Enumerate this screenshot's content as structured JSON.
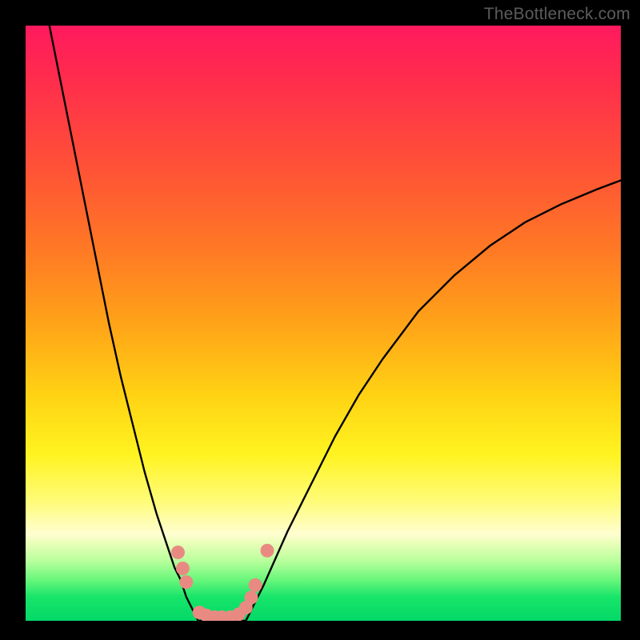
{
  "watermark": "TheBottleneck.com",
  "colors": {
    "frame": "#000000",
    "curve": "#000000",
    "marker": "#e98a82",
    "marker_edge": "#d46e66"
  },
  "chart_data": {
    "type": "line",
    "title": "",
    "xlabel": "",
    "ylabel": "",
    "xlim": [
      0,
      100
    ],
    "ylim": [
      0,
      100
    ],
    "note": "Axes unlabeled; values below are read off as percentages of the plotting area (0–100). y measured from the green bottom (0 = bottom edge of colored square, 100 = top).",
    "series": [
      {
        "name": "left-branch",
        "x": [
          4,
          6,
          8,
          10,
          12,
          14,
          16,
          18,
          20,
          22,
          24,
          25,
          26,
          27,
          28,
          29
        ],
        "y": [
          100,
          90,
          80,
          70,
          60,
          50,
          41,
          33,
          25,
          18,
          12,
          9,
          7,
          4,
          2,
          0
        ]
      },
      {
        "name": "valley-floor",
        "x": [
          29,
          30,
          31,
          32,
          33,
          34,
          35,
          36,
          37
        ],
        "y": [
          0,
          0,
          0,
          0,
          0,
          0,
          0,
          0,
          0
        ]
      },
      {
        "name": "right-branch",
        "x": [
          37,
          40,
          44,
          48,
          52,
          56,
          60,
          66,
          72,
          78,
          84,
          90,
          96,
          100
        ],
        "y": [
          0,
          6,
          15,
          23,
          31,
          38,
          44,
          52,
          58,
          63,
          67,
          70,
          72.5,
          74
        ]
      }
    ],
    "markers": {
      "name": "salmon-dots",
      "note": "Approximate positions of the pink/salmon circular markers near the valley, in the same 0–100 coordinate space.",
      "points": [
        {
          "x": 25.6,
          "y": 11.5
        },
        {
          "x": 26.4,
          "y": 8.8
        },
        {
          "x": 27.0,
          "y": 6.5
        },
        {
          "x": 29.2,
          "y": 1.4
        },
        {
          "x": 30.4,
          "y": 0.9
        },
        {
          "x": 31.8,
          "y": 0.6
        },
        {
          "x": 33.0,
          "y": 0.6
        },
        {
          "x": 34.4,
          "y": 0.6
        },
        {
          "x": 35.8,
          "y": 1.1
        },
        {
          "x": 37.0,
          "y": 2.2
        },
        {
          "x": 37.9,
          "y": 3.9
        },
        {
          "x": 38.6,
          "y": 6.0
        },
        {
          "x": 40.6,
          "y": 11.8
        }
      ],
      "radius_px": 8.5
    }
  }
}
